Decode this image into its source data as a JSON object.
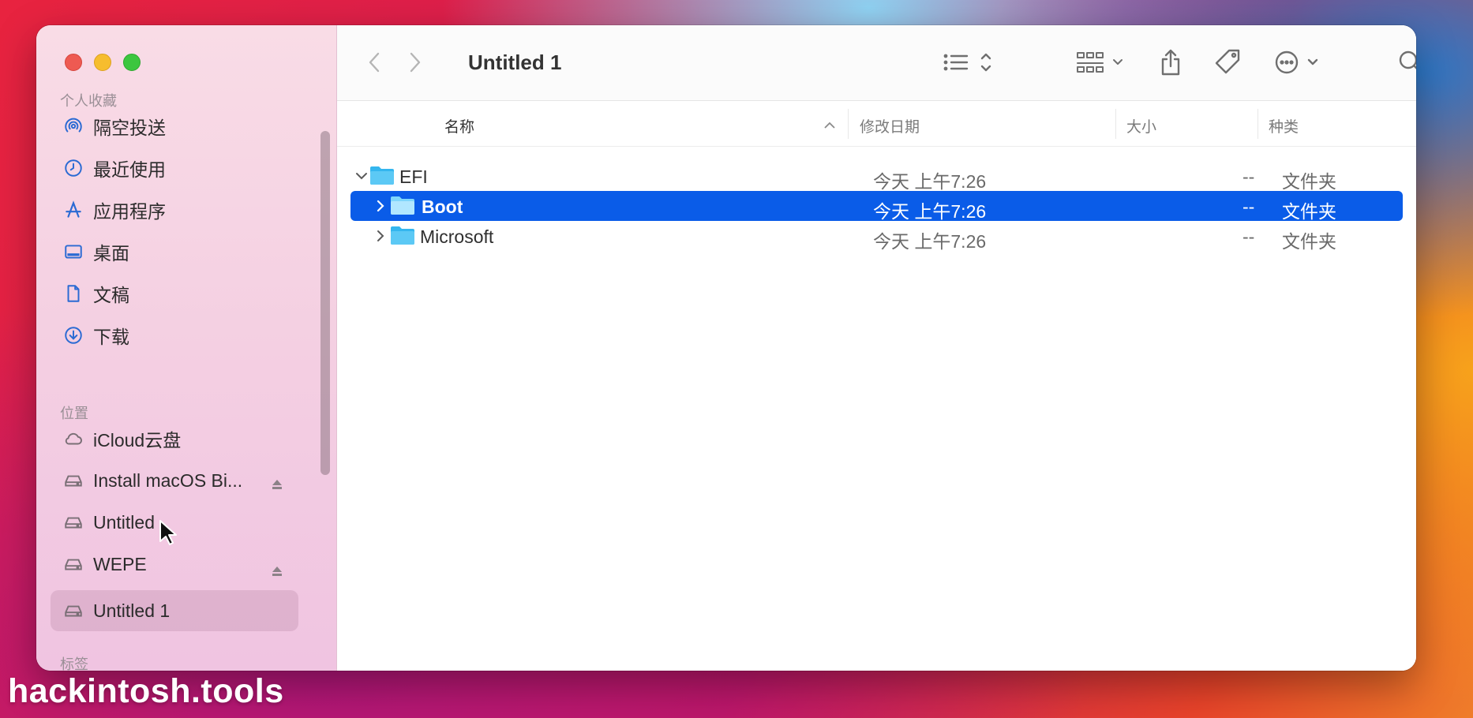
{
  "window": {
    "title": "Untitled 1"
  },
  "sidebar": {
    "favorites_header": "个人收藏",
    "favorites": [
      {
        "label": "隔空投送",
        "icon": "airdrop-icon"
      },
      {
        "label": "最近使用",
        "icon": "clock-icon"
      },
      {
        "label": "应用程序",
        "icon": "applications-icon"
      },
      {
        "label": "桌面",
        "icon": "desktop-icon"
      },
      {
        "label": "文稿",
        "icon": "document-icon"
      },
      {
        "label": "下载",
        "icon": "download-icon"
      }
    ],
    "locations_header": "位置",
    "locations": [
      {
        "label": "iCloud云盘",
        "icon": "cloud-icon"
      },
      {
        "label": "Install macOS Bi...",
        "icon": "drive-icon",
        "ejectable": true
      },
      {
        "label": "Untitled",
        "icon": "drive-icon"
      },
      {
        "label": "WEPE",
        "icon": "drive-icon",
        "ejectable": true
      },
      {
        "label": "Untitled 1",
        "icon": "drive-icon",
        "selected": true
      }
    ],
    "tags_header": "标签"
  },
  "toolbar": {
    "back_icon": "chevron-left-icon",
    "forward_icon": "chevron-right-icon",
    "view_icon": "list-view-icon",
    "group_icon": "grid-group-icon",
    "share_icon": "share-icon",
    "tag_icon": "tag-icon",
    "more_icon": "ellipsis-circle-icon",
    "search_icon": "search-icon"
  },
  "columns": {
    "name": "名称",
    "modified": "修改日期",
    "size": "大小",
    "kind": "种类"
  },
  "rows": [
    {
      "name": "EFI",
      "modified": "今天 上午7:26",
      "size": "--",
      "kind": "文件夹",
      "expanded": true,
      "level": 0,
      "selected": false
    },
    {
      "name": "Boot",
      "modified": "今天 上午7:26",
      "size": "--",
      "kind": "文件夹",
      "expanded": false,
      "level": 1,
      "selected": true
    },
    {
      "name": "Microsoft",
      "modified": "今天 上午7:26",
      "size": "--",
      "kind": "文件夹",
      "expanded": false,
      "level": 1,
      "selected": false
    }
  ],
  "watermark": "hackintosh.tools",
  "colors": {
    "selection": "#0a5ce8",
    "folder": "#34b6ee",
    "sidebar_bg": "#f4cfe2"
  }
}
